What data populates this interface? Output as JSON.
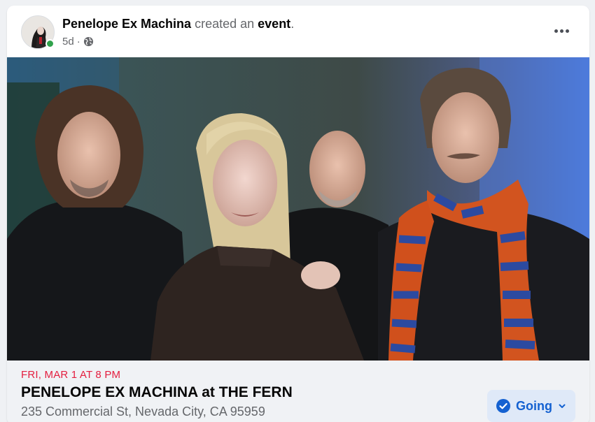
{
  "post": {
    "author": "Penelope Ex Machina",
    "action_text": "created an",
    "action_object": "event",
    "punct": ".",
    "time_ago": "5d",
    "separator": "·",
    "audience_icon": "globe-icon",
    "more_icon": "more-options-icon",
    "online": true
  },
  "event": {
    "date": "FRI, MAR 1 AT 8 PM",
    "title": "PENELOPE EX MACHINA at THE FERN",
    "address": "235 Commercial St, Nevada City, CA 95959",
    "rsvp_label": "Going",
    "rsvp_icon": "check-circle-icon",
    "rsvp_menu_icon": "chevron-down-icon"
  },
  "colors": {
    "date_red": "#e41e3f",
    "rsvp_blue": "#1461d1",
    "rsvp_bg": "#dfe9f8",
    "online_green": "#31a24c"
  }
}
